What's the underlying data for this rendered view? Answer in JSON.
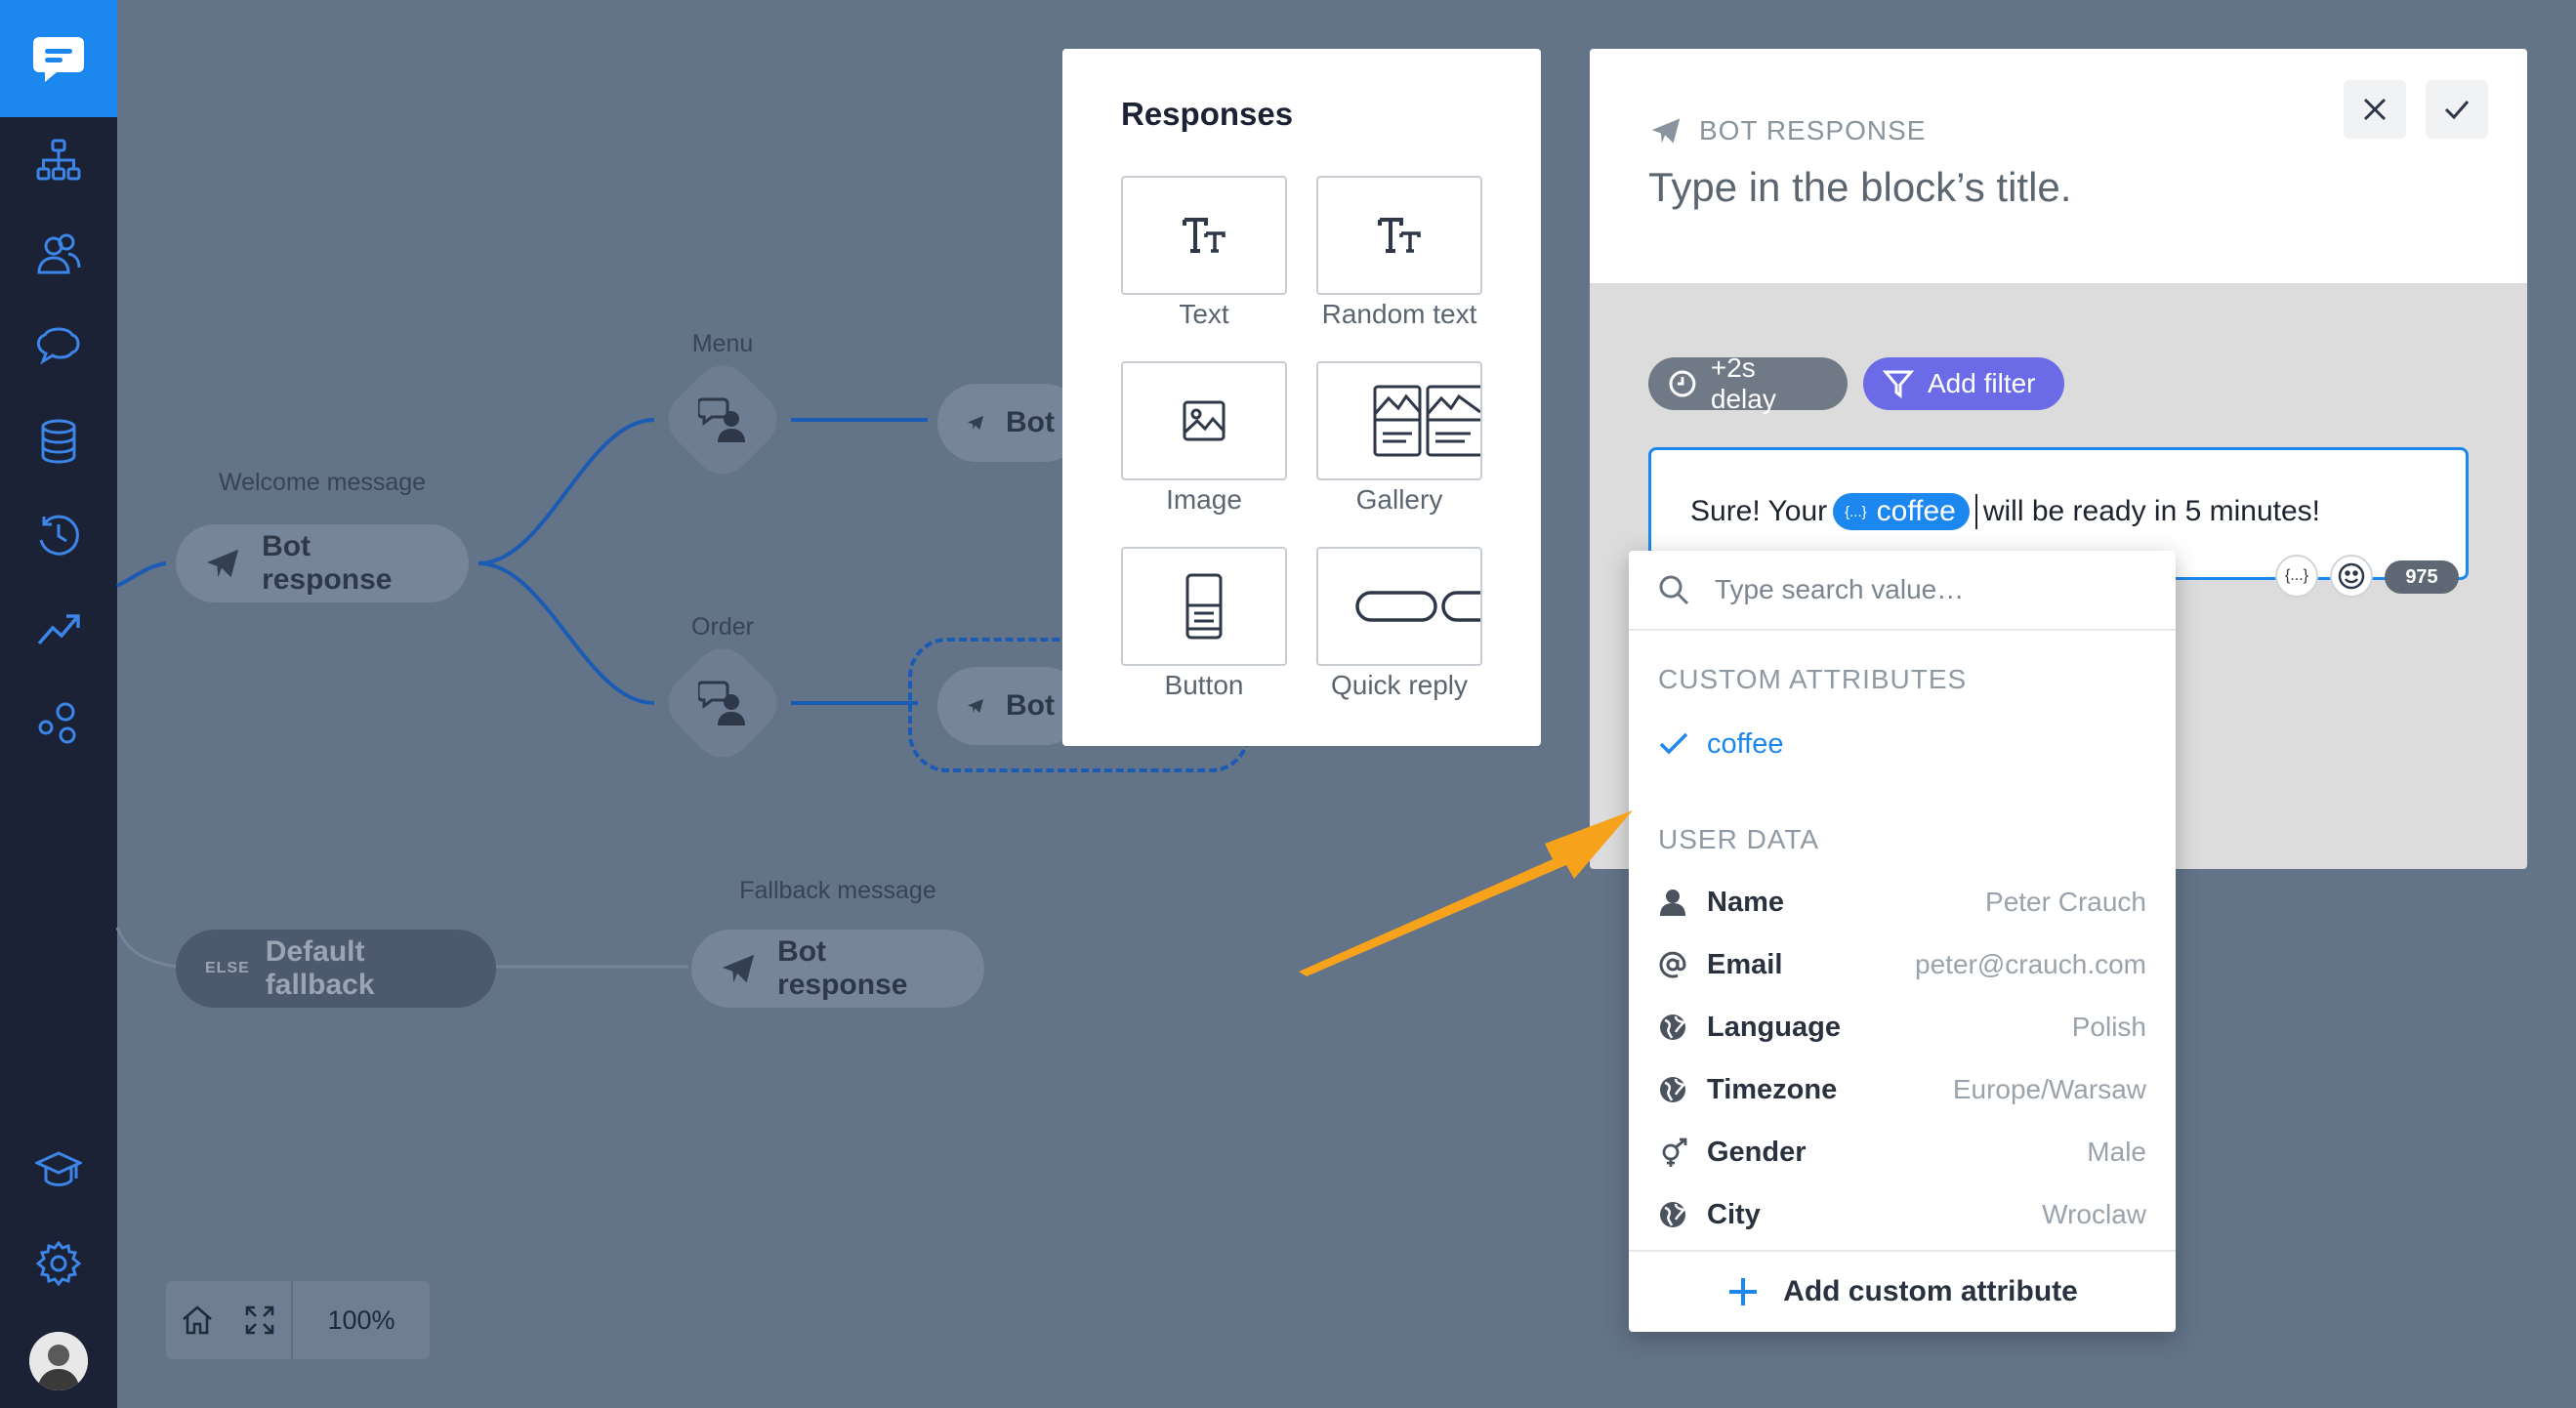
{
  "canvas": {
    "labels": {
      "welcome": "Welcome message",
      "menu": "Menu",
      "order": "Order",
      "fallback": "Fallback message"
    },
    "nodes": {
      "welcome_bot": "Bot response",
      "menu_bot": "Bot",
      "order_bot": "Bot",
      "default_fallback_tag": "ELSE",
      "default_fallback": "Default fallback",
      "fallback_bot": "Bot response"
    },
    "zoom": "100%"
  },
  "responses": {
    "title": "Responses",
    "items": [
      "Text",
      "Random text",
      "Image",
      "Gallery",
      "Button",
      "Quick reply"
    ]
  },
  "editor": {
    "type_label": "BOT RESPONSE",
    "title_placeholder": "Type in the block’s title.",
    "delay_label": "+2s delay",
    "filter_label": "Add filter",
    "message": {
      "before": "Sure! Your",
      "variable": "coffee",
      "after": "will be ready in 5 minutes!"
    },
    "attr_button": "{...}",
    "char_count": "975"
  },
  "dropdown": {
    "search_placeholder": "Type search value…",
    "custom_title": "CUSTOM ATTRIBUTES",
    "custom_items": [
      "coffee"
    ],
    "user_title": "USER DATA",
    "user_items": [
      {
        "name": "Name",
        "value": "Peter Crauch",
        "icon": "user-icon"
      },
      {
        "name": "Email",
        "value": "peter@crauch.com",
        "icon": "at-icon"
      },
      {
        "name": "Language",
        "value": "Polish",
        "icon": "globe-icon"
      },
      {
        "name": "Timezone",
        "value": "Europe/Warsaw",
        "icon": "globe-icon"
      },
      {
        "name": "Gender",
        "value": "Male",
        "icon": "gender-icon"
      },
      {
        "name": "City",
        "value": "Wroclaw",
        "icon": "globe-icon"
      }
    ],
    "add_label": "Add custom attribute"
  },
  "colors": {
    "accent": "#1c87ef",
    "canvas_bg": "#637388",
    "sidebar_bg": "#1b2236",
    "filter_chip": "#6b6be8",
    "arrow": "#f7a21b"
  }
}
